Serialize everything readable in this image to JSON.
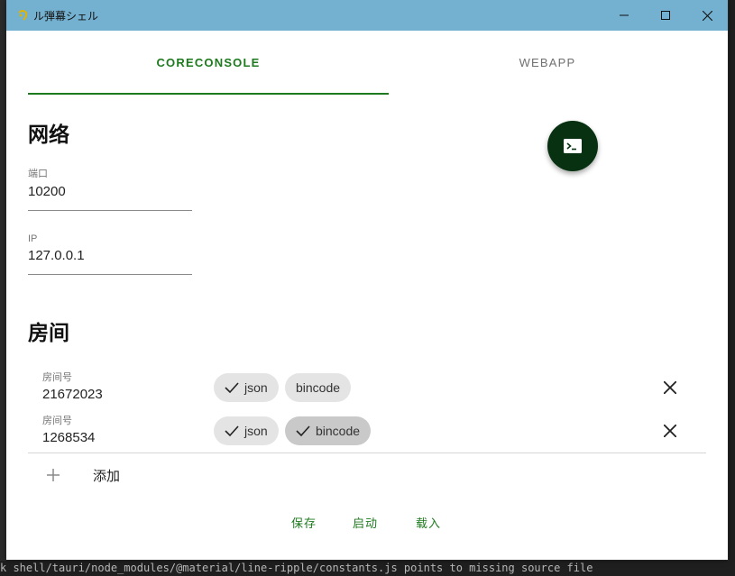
{
  "window": {
    "title": "ル弾幕シェル"
  },
  "tabs": [
    {
      "label": "CORECONSOLE",
      "active": true
    },
    {
      "label": "WEBAPP",
      "active": false
    }
  ],
  "network": {
    "title": "网络",
    "port": {
      "label": "端口",
      "value": "10200"
    },
    "ip": {
      "label": "IP",
      "value": "127.0.0.1"
    }
  },
  "fab": {
    "icon": "terminal-icon"
  },
  "rooms": {
    "title": "房间",
    "items": [
      {
        "label": "房间号",
        "value": "21672023",
        "chips": [
          {
            "label": "json",
            "checked": true
          },
          {
            "label": "bincode",
            "checked": false
          }
        ]
      },
      {
        "label": "房间号",
        "value": "1268534",
        "chips": [
          {
            "label": "json",
            "checked": true
          },
          {
            "label": "bincode",
            "checked": true
          }
        ]
      }
    ],
    "add_label": "添加"
  },
  "actions": {
    "save": "保存",
    "start": "启动",
    "load": "载入"
  },
  "background": {
    "terminal_text": "k shell/tauri/node_modules/@material/line-ripple/constants.js  points to missing source file"
  },
  "colors": {
    "titlebar": "#74b0cf",
    "accent": "#1e7a1e",
    "fab": "#073110"
  }
}
